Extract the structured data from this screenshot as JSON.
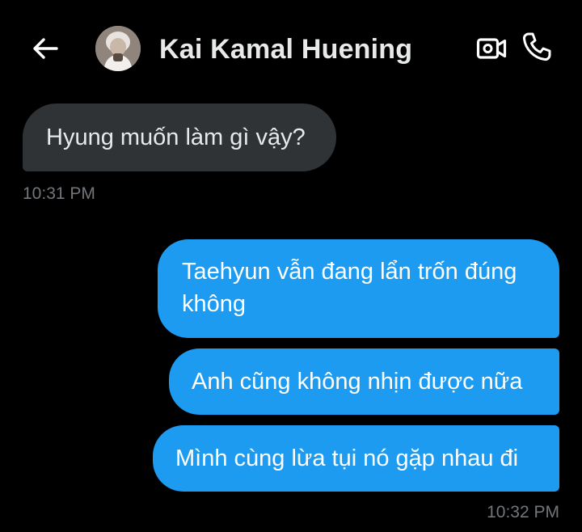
{
  "header": {
    "contact_name": "Kai Kamal Huening",
    "back_icon": "arrow-left-icon",
    "video_icon": "video-camera-icon",
    "call_icon": "phone-icon"
  },
  "messages": [
    {
      "direction": "in",
      "text": "Hyung muốn làm gì vậy?"
    },
    {
      "direction": "out",
      "text": "Taehyun vẫn đang lẩn trốn đúng không"
    },
    {
      "direction": "out",
      "text": "Anh cũng không nhịn được nữa"
    },
    {
      "direction": "out",
      "text": "Mình cùng lừa tụi nó gặp nhau đi"
    }
  ],
  "timestamps": {
    "incoming": "10:31 PM",
    "outgoing": "10:32 PM"
  },
  "colors": {
    "background": "#000000",
    "incoming_bubble": "#2f3336",
    "outgoing_bubble": "#1d9bf0",
    "timestamp": "#71767b",
    "text": "#e7e9ea"
  }
}
